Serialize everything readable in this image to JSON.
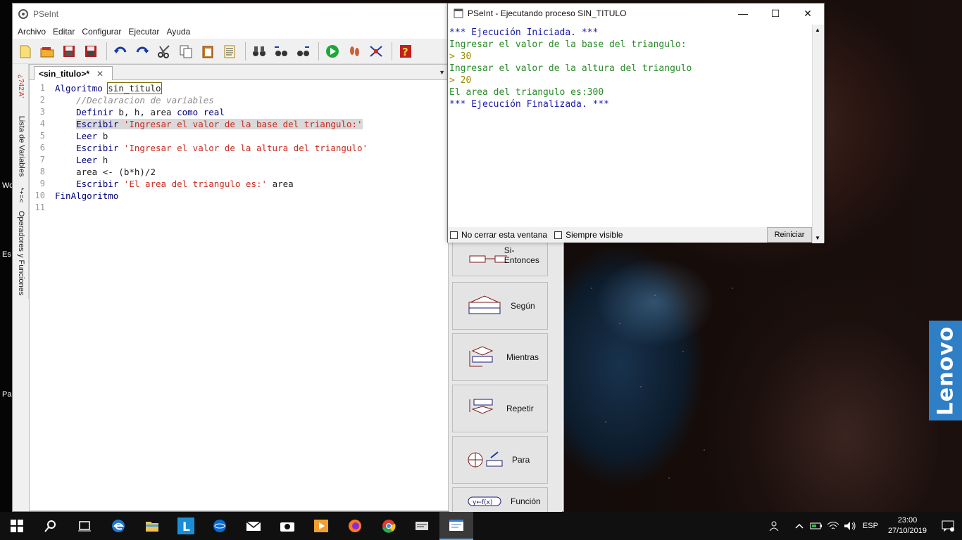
{
  "app": {
    "title": "PSeInt"
  },
  "menu": [
    "Archivo",
    "Editar",
    "Configurar",
    "Ejecutar",
    "Ayuda"
  ],
  "side_tabs": {
    "variables": "Lista de Variables",
    "operators": "Operadores y Funciones"
  },
  "editor": {
    "tab_label": "<sin_titulo>*",
    "lines": [
      {
        "n": "1",
        "parts": [
          [
            "kw",
            "Algoritmo "
          ],
          [
            "var boxed",
            "sin_titulo"
          ]
        ]
      },
      {
        "n": "2",
        "parts": [
          [
            "cm",
            "    //Declaracion de variables"
          ]
        ]
      },
      {
        "n": "3",
        "parts": [
          [
            "kw",
            "    Definir "
          ],
          [
            "var",
            "b, h, area "
          ],
          [
            "kw",
            "como real"
          ]
        ]
      },
      {
        "n": "4",
        "parts": [
          [
            "var",
            "    "
          ],
          [
            "kw hl",
            "Escribir "
          ],
          [
            "str hl",
            "'Ingresar el valor de la base del triangulo:'"
          ]
        ]
      },
      {
        "n": "5",
        "parts": [
          [
            "kw",
            "    Leer "
          ],
          [
            "var",
            "b"
          ]
        ]
      },
      {
        "n": "6",
        "parts": [
          [
            "kw",
            "    Escribir "
          ],
          [
            "str",
            "'Ingresar el valor de la altura del triangulo'"
          ]
        ]
      },
      {
        "n": "7",
        "parts": [
          [
            "kw",
            "    Leer "
          ],
          [
            "var",
            "h"
          ]
        ]
      },
      {
        "n": "8",
        "parts": [
          [
            "var",
            "    area <- (b*h)/"
          ],
          [
            "num",
            "2"
          ]
        ]
      },
      {
        "n": "9",
        "parts": [
          [
            "kw",
            "    Escribir "
          ],
          [
            "str",
            "'El area del triangulo es:'"
          ],
          [
            "var",
            " area"
          ]
        ]
      },
      {
        "n": "10",
        "parts": [
          [
            "kw",
            "FinAlgoritmo"
          ]
        ]
      },
      {
        "n": "11",
        "parts": []
      }
    ]
  },
  "shapes": [
    "Si-Entonces",
    "Según",
    "Mientras",
    "Repetir",
    "Para",
    "Función"
  ],
  "console": {
    "title": "PSeInt - Ejecutando proceso SIN_TITULO",
    "lines": [
      {
        "cls": "c-blue",
        "text": "*** Ejecución Iniciada. ***"
      },
      {
        "cls": "c-green",
        "text": "Ingresar el valor de la base del triangulo:"
      },
      {
        "cls": "c-olive",
        "text": "> 30"
      },
      {
        "cls": "c-green",
        "text": "Ingresar el valor de la altura del triangulo"
      },
      {
        "cls": "c-olive",
        "text": "> 20"
      },
      {
        "cls": "c-green",
        "text": "El area del triangulo es:300"
      },
      {
        "cls": "c-blue",
        "text": "*** Ejecución Finalizada. ***"
      }
    ],
    "no_close_label": "No cerrar esta ventana",
    "always_visible_label": "Siempre visible",
    "restart_label": "Reiniciar"
  },
  "tray": {
    "language": "ESP",
    "time": "23:00",
    "date": "27/10/2019"
  },
  "wallpaper": {
    "badge_text": "Lenovo",
    "badge_color": "#2e7fc6"
  },
  "desktop_labels": [
    "Wo",
    "Es",
    "Pa"
  ]
}
